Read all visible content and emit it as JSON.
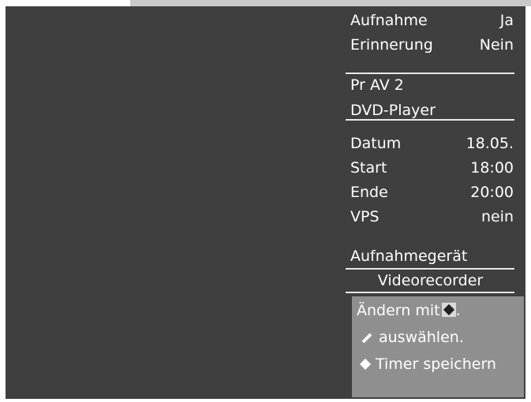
{
  "top_fields": [
    {
      "label": "Aufnahme",
      "value": "Ja"
    },
    {
      "label": "Erinnerung",
      "value": "Nein"
    }
  ],
  "program": {
    "line1": "Pr  AV 2",
    "line2": "DVD-Player"
  },
  "schedule": [
    {
      "label": "Datum",
      "value": "18.05."
    },
    {
      "label": "Start",
      "value": "18:00"
    },
    {
      "label": "Ende",
      "value": "20:00"
    },
    {
      "label": "VPS",
      "value": "nein"
    }
  ],
  "recording_device": {
    "label": "Aufnahmegerät",
    "value": "Videorecorder"
  },
  "help": {
    "line1_text": "Ändern mit",
    "line1_suffix": ".",
    "line2_text": "auswählen.",
    "line3_text": "Timer speichern",
    "icons": [
      "diamond-nav-icon",
      "slash-icon",
      "small-diamond-icon"
    ]
  },
  "colors": {
    "screen_bg": "#3f3f3f",
    "help_bg": "#8f8f8f",
    "text": "#ffffff"
  }
}
